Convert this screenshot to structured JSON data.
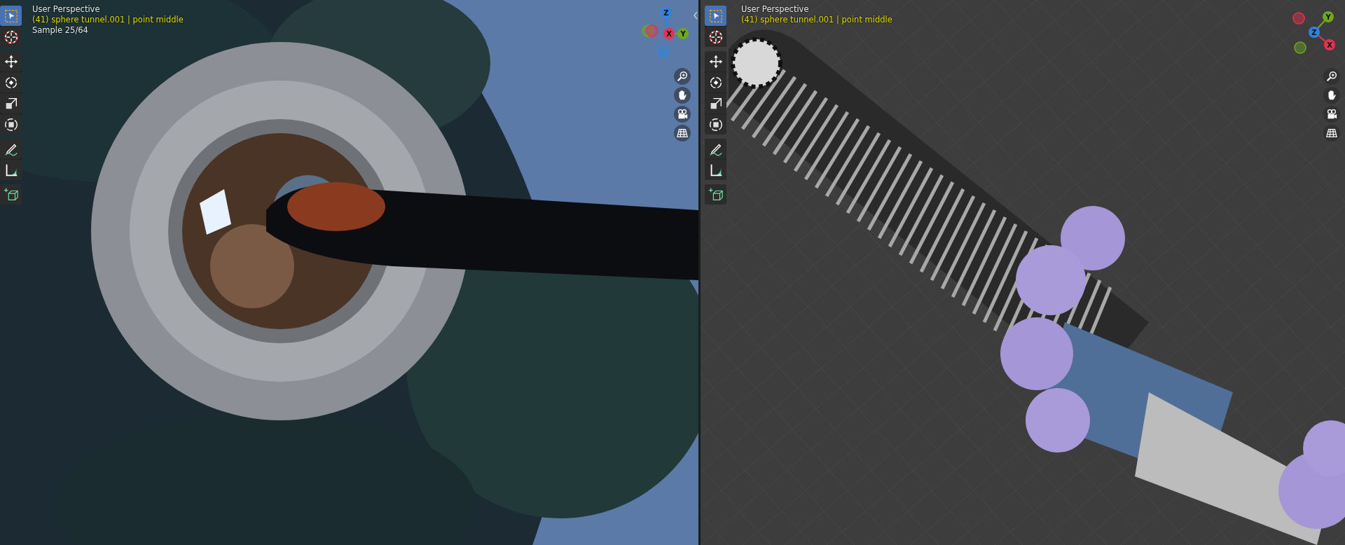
{
  "viewports": [
    {
      "kind": "render",
      "title": "User Perspective",
      "object_info": "(41) sphere tunnel.001 | point middle",
      "sample": "Sample 25/64",
      "tool_groups": [
        [
          {
            "kind": "select",
            "selected": true
          },
          {
            "kind": "cursor",
            "selected": false
          }
        ],
        [
          {
            "kind": "move",
            "selected": false
          },
          {
            "kind": "rotate",
            "selected": false
          },
          {
            "kind": "scale",
            "selected": false
          },
          {
            "kind": "transform",
            "selected": false
          }
        ],
        [
          {
            "kind": "annotate",
            "selected": false
          },
          {
            "kind": "measure",
            "selected": false
          }
        ],
        [
          {
            "kind": "add",
            "selected": false
          }
        ]
      ],
      "gizmo": [
        {
          "label": "Z",
          "color": "#2f83e0"
        },
        {
          "label": "X",
          "color": "#e8304f"
        },
        {
          "label": "Y",
          "color": "#6ea81e"
        }
      ],
      "nav_buttons": [
        {
          "kind": "zoom"
        },
        {
          "kind": "pan"
        },
        {
          "kind": "camera"
        },
        {
          "kind": "ortho"
        }
      ]
    },
    {
      "kind": "solid",
      "title": "User Perspective",
      "object_info": "(41) sphere tunnel.001 | point middle",
      "tool_groups": [
        [
          {
            "kind": "select",
            "selected": true
          },
          {
            "kind": "cursor",
            "selected": false
          }
        ],
        [
          {
            "kind": "move",
            "selected": false
          },
          {
            "kind": "rotate",
            "selected": false
          },
          {
            "kind": "scale",
            "selected": false
          },
          {
            "kind": "transform",
            "selected": false
          }
        ],
        [
          {
            "kind": "annotate",
            "selected": false
          },
          {
            "kind": "measure",
            "selected": false
          }
        ],
        [
          {
            "kind": "add",
            "selected": false
          }
        ]
      ],
      "gizmo": [
        {
          "label": "Y",
          "color": "#6ea81e"
        },
        {
          "label": "Z",
          "color": "#2f83e0"
        },
        {
          "label": "X",
          "color": "#e8304f"
        }
      ],
      "nav_buttons": [
        {
          "kind": "zoom"
        },
        {
          "kind": "pan"
        },
        {
          "kind": "camera"
        },
        {
          "kind": "ortho"
        }
      ]
    }
  ]
}
